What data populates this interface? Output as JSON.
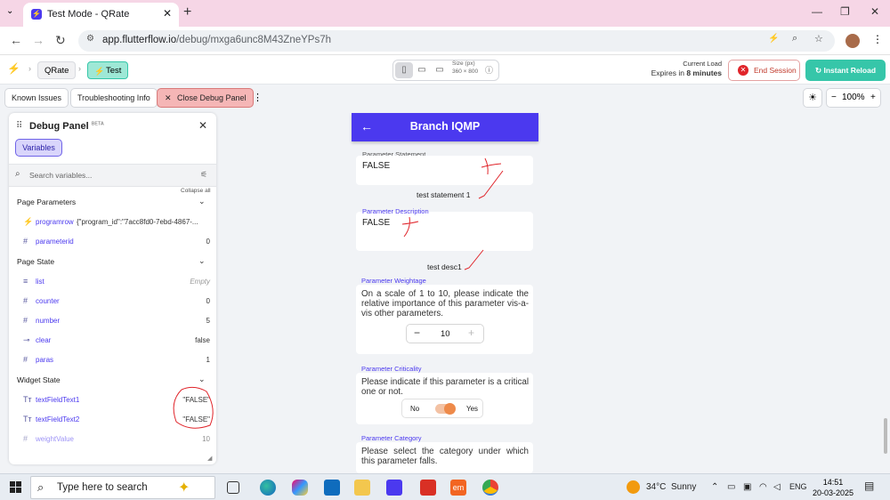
{
  "browser": {
    "tab_title": "Test Mode - QRate",
    "url_host": "app.flutterflow.io",
    "url_path": "/debug/mxga6unc8M43ZneYPs7h"
  },
  "topbar": {
    "crumb_project": "QRate",
    "crumb_test": "Test",
    "size_label": "Size (px)",
    "size_value": "360 × 800",
    "current_load_label": "Current Load",
    "expires_prefix": "Expires in",
    "expires_value": "8 minutes",
    "end_session": "End Session",
    "instant_reload": "Instant Reload"
  },
  "toolbar": {
    "known_issues": "Known Issues",
    "troubleshooting": "Troubleshooting Info",
    "close_debug": "Close Debug Panel",
    "zoom": "100%"
  },
  "debug_panel": {
    "title": "Debug Panel",
    "beta": "BETA",
    "variables_tab": "Variables",
    "search_placeholder": "Search variables...",
    "collapse_all": "Collapse all",
    "sections": [
      {
        "title": "Page Parameters",
        "rows": [
          {
            "icon": "bolt",
            "name": "programrow",
            "value": "{\"program_id\":\"7acc8fd0-7ebd-4867-..."
          },
          {
            "icon": "hash",
            "name": "parameterid",
            "value": "0"
          }
        ]
      },
      {
        "title": "Page State",
        "rows": [
          {
            "icon": "list",
            "name": "list",
            "value": "Empty"
          },
          {
            "icon": "hash",
            "name": "counter",
            "value": "0"
          },
          {
            "icon": "hash",
            "name": "number",
            "value": "5"
          },
          {
            "icon": "toggle",
            "name": "clear",
            "value": "false"
          },
          {
            "icon": "hash",
            "name": "paras",
            "value": "1"
          }
        ]
      },
      {
        "title": "Widget State",
        "rows": [
          {
            "icon": "text",
            "name": "textFieldText1",
            "value": "\"FALSE\""
          },
          {
            "icon": "text",
            "name": "textFieldText2",
            "value": "\"FALSE\""
          },
          {
            "icon": "hash",
            "name": "weightValue",
            "value": "10"
          }
        ]
      }
    ]
  },
  "app": {
    "title": "Branch IQMP",
    "statement_label": "Parameter Statement",
    "statement_value": "FALSE",
    "statement_text": "test statement 1",
    "description_label": "Parameter Description",
    "description_value": "FALSE",
    "description_text": "test desc1",
    "weightage_label": "Parameter Weightage",
    "weightage_text": "On a scale of 1 to 10, please indicate the relative importance of this parameter vis-a-vis other parameters.",
    "weight_value": "10",
    "weight_minus": "−",
    "weight_plus": "+",
    "criticality_label": "Parameter Criticality",
    "criticality_text": "Please indicate if this parameter is a critical one or not.",
    "no_label": "No",
    "yes_label": "Yes",
    "category_label": "Parameter Category",
    "category_text": "Please select the category under which this parameter falls."
  },
  "taskbar": {
    "search_placeholder": "Type here to search",
    "weather_temp": "34°C",
    "weather_text": "Sunny",
    "lang": "ENG",
    "time": "14:51",
    "date": "20-03-2025"
  },
  "colors": {
    "accent": "#4b39ef",
    "teal": "#36c6a9",
    "annotation_red": "#e0242a"
  }
}
